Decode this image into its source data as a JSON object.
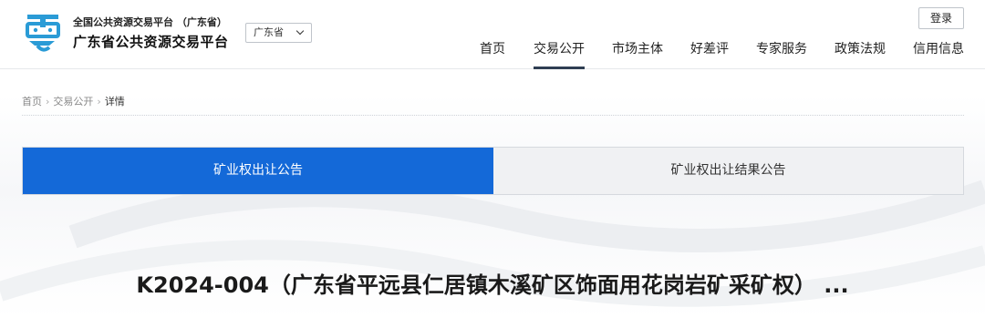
{
  "header": {
    "brand_small": "全国公共资源交易平台  （广东省）",
    "brand_big": "广东省公共资源交易平台",
    "region_select": "广东省",
    "login_label": "登录",
    "nav": [
      {
        "label": "首页"
      },
      {
        "label": "交易公开"
      },
      {
        "label": "市场主体"
      },
      {
        "label": "好差评"
      },
      {
        "label": "专家服务"
      },
      {
        "label": "政策法规"
      },
      {
        "label": "信用信息"
      }
    ],
    "active_nav": "交易公开"
  },
  "breadcrumb": [
    "首页",
    "交易公开",
    "详情"
  ],
  "tabs": [
    {
      "label": "矿业权出让公告"
    },
    {
      "label": "矿业权出让结果公告"
    }
  ],
  "title": "K2024-004（广东省平远县仁居镇木溪矿区饰面用花岗岩矿采矿权） ...",
  "colors": {
    "accent": "#1469d8",
    "nav_underline": "#2f3e53",
    "logo_blue": "#2a9bd6"
  }
}
